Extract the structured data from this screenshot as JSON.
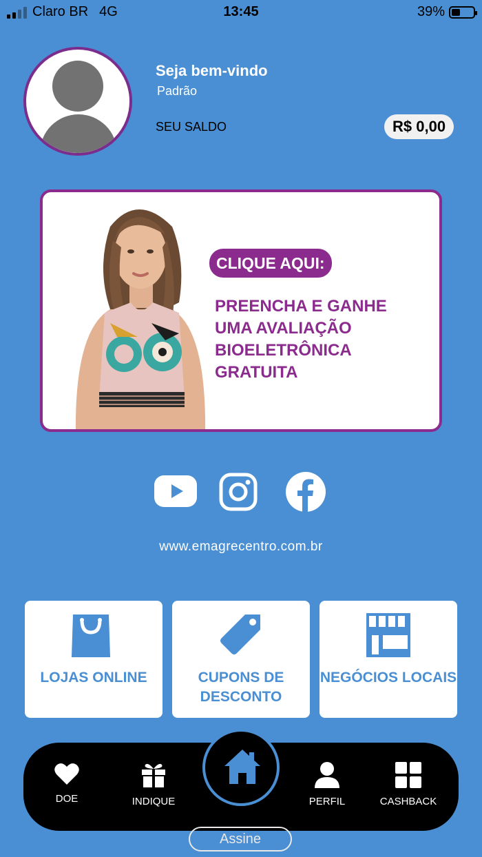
{
  "status_bar": {
    "carrier": "Claro BR",
    "network": "4G",
    "time": "13:45",
    "battery": "39%",
    "battery_level": 0.39
  },
  "profile": {
    "welcome": "Seja bem-vindo",
    "tier": "Padrão",
    "balance_label": "SEU SALDO",
    "balance": "R$ 0,00"
  },
  "banner": {
    "cta": "CLIQUE AQUI:",
    "text": "PREENCHA E GANHE UMA AVALIAÇÃO BIOELETRÔNICA GRATUITA",
    "accent_color": "#8b2b8e"
  },
  "social": {
    "icons": [
      "youtube-icon",
      "instagram-icon",
      "facebook-icon"
    ],
    "website": "www.emagrecentro.com.br"
  },
  "categories": [
    {
      "label": "LOJAS ONLINE",
      "icon": "shopping-bag-icon"
    },
    {
      "label": "CUPONS DE DESCONTO",
      "icon": "tag-icon"
    },
    {
      "label": "NEGÓCIOS LOCAIS",
      "icon": "storefront-icon"
    }
  ],
  "nav": {
    "items": [
      {
        "label": "DOE",
        "icon": "heart-icon"
      },
      {
        "label": "INDIQUE",
        "icon": "gift-icon"
      },
      {
        "label": "",
        "icon": "home-icon"
      },
      {
        "label": "PERFIL",
        "icon": "person-icon"
      },
      {
        "label": "CASHBACK",
        "icon": "grid-icon"
      }
    ]
  },
  "assine_label": "Assine",
  "colors": {
    "background": "#4a8fd3",
    "purple": "#8b2b8e",
    "nav": "#000000"
  }
}
